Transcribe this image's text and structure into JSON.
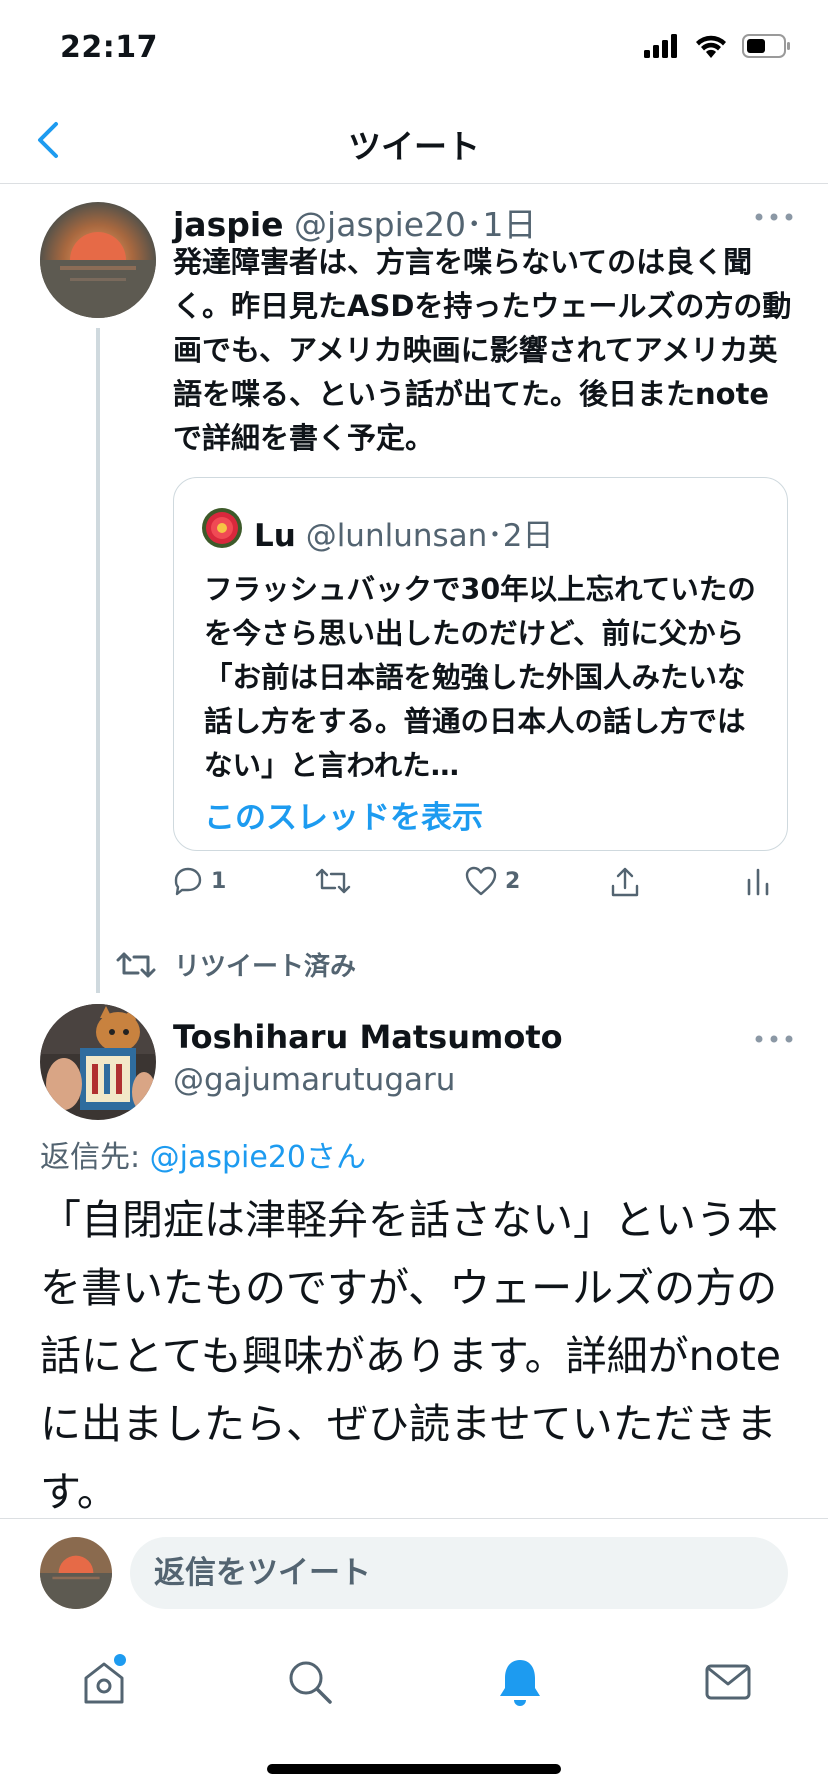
{
  "status_bar": {
    "time": "22:17",
    "icons": [
      "signal-icon",
      "wifi-icon",
      "battery-icon"
    ]
  },
  "header": {
    "title": "ツイート",
    "back_icon": "chevron-left-icon"
  },
  "tweet1": {
    "display_name": "jaspie",
    "handle_time": "@jaspie20･1日",
    "body": "発達障害者は、方言を喋らないてのは良く聞く。昨日見たASDを持ったウェールズの方の動画でも、アメリカ映画に影響されてアメリカ英語を喋る、という話が出てた。後日またnoteで詳細を書く予定。",
    "quote": {
      "display_name": "Lu",
      "handle_time": "@lunlunsan･2日",
      "body": "フラッシュバックで30年以上忘れていたのを今さら思い出したのだけど、前に父から「お前は日本語を勉強した外国人みたいな話し方をする。普通の日本人の話し方ではない」と言われた…",
      "show_thread": "このスレッドを表示"
    },
    "actions": {
      "reply_count": "1",
      "like_count": "2"
    }
  },
  "retweet_label": "リツイート済み",
  "tweet2": {
    "display_name": "Toshiharu Matsumoto",
    "handle": "@gajumarutugaru",
    "reply_prefix": "返信先: ",
    "reply_mention": "@jaspie20さん",
    "body": "「自閉症は津軽弁を話さない」という本を書いたものですが、ウェールズの方の話にとても興味があります。詳細がnoteに出ましたら、ぜひ読ませていただきます。"
  },
  "composer": {
    "placeholder": "返信をツイート"
  },
  "tabbar": {
    "tabs": [
      "home-icon",
      "search-icon",
      "notifications-icon",
      "messages-icon"
    ]
  },
  "colors": {
    "accent": "#1d9bf0",
    "secondary_text": "#536471",
    "divider": "#dcdfe2"
  }
}
